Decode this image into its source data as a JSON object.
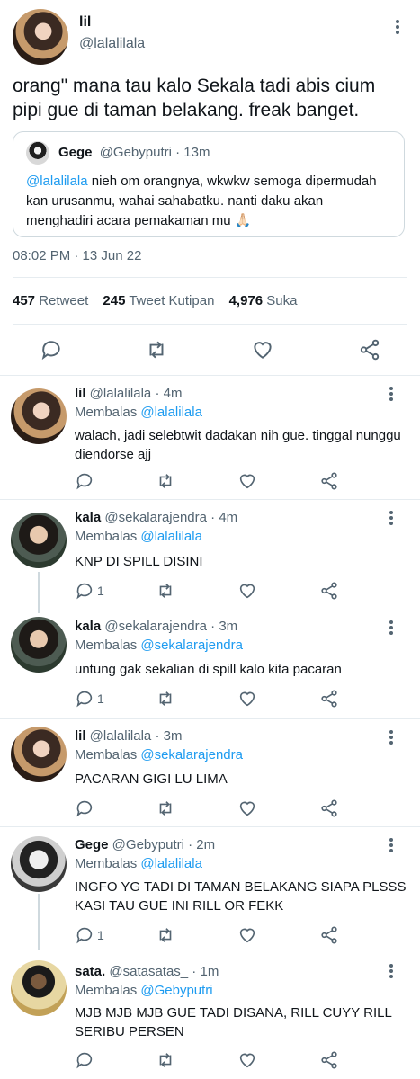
{
  "main_tweet": {
    "display_name": "lil",
    "handle": "@lalalilala",
    "text": "orang\" mana tau kalo Sekala tadi abis cium pipi gue di taman belakang. freak banget.",
    "quote": {
      "display_name": "Gege",
      "handle_time": "@Gebyputri · 13m",
      "mention": "@lalalilala",
      "text": " nieh om orangnya, wkwkw semoga dipermudah kan urusanmu, wahai sahabatku. nanti daku akan menghadiri acara pemakaman mu 🙏🏻"
    },
    "timestamp": "08:02 PM · 13 Jun 22",
    "stats": {
      "retweets": "457",
      "retweets_label": "Retweet",
      "quotes": "245",
      "quotes_label": "Tweet Kutipan",
      "likes": "4,976",
      "likes_label": "Suka"
    }
  },
  "replies": [
    {
      "name": "lil",
      "handle_time": " @lalalilala · 4m",
      "replying_label": "Membalas ",
      "replying_to": "@lalalilala",
      "text": "walach, jadi selebtwit dadakan nih gue. tinggal nunggu diendorse ajj",
      "reply_count": ""
    },
    {
      "name": "kala",
      "handle_time": " @sekalarajendra · 4m",
      "replying_label": "Membalas ",
      "replying_to": "@lalalilala",
      "text": "KNP DI SPILL DISINI",
      "reply_count": "1"
    },
    {
      "name": "kala",
      "handle_time": " @sekalarajendra · 3m",
      "replying_label": "Membalas ",
      "replying_to": "@sekalarajendra",
      "text": "untung gak sekalian di spill kalo kita pacaran",
      "reply_count": "1"
    },
    {
      "name": "lil",
      "handle_time": " @lalalilala · 3m",
      "replying_label": "Membalas ",
      "replying_to": "@sekalarajendra",
      "text": "PACARAN GIGI LU LIMA",
      "reply_count": ""
    },
    {
      "name": "Gege",
      "handle_time": " @Gebyputri · 2m",
      "replying_label": "Membalas ",
      "replying_to": "@lalalilala",
      "text": "INGFO YG TADI DI TAMAN BELAKANG SIAPA PLSSS KASI TAU GUE INI RILL OR FEKK",
      "reply_count": "1"
    },
    {
      "name": "sata.",
      "handle_time": " @satasatas_ · 1m",
      "replying_label": "Membalas ",
      "replying_to": "@Gebyputri",
      "text": "MJB MJB MJB GUE TADI DISANA, RILL CUYY RILL SERIBU PERSEN",
      "reply_count": ""
    }
  ],
  "colors": {
    "link": "#1d9bf0",
    "muted": "#536471",
    "border": "#e6ecf0"
  },
  "icons": [
    "more-icon",
    "reply-icon",
    "retweet-icon",
    "like-icon",
    "share-icon"
  ]
}
